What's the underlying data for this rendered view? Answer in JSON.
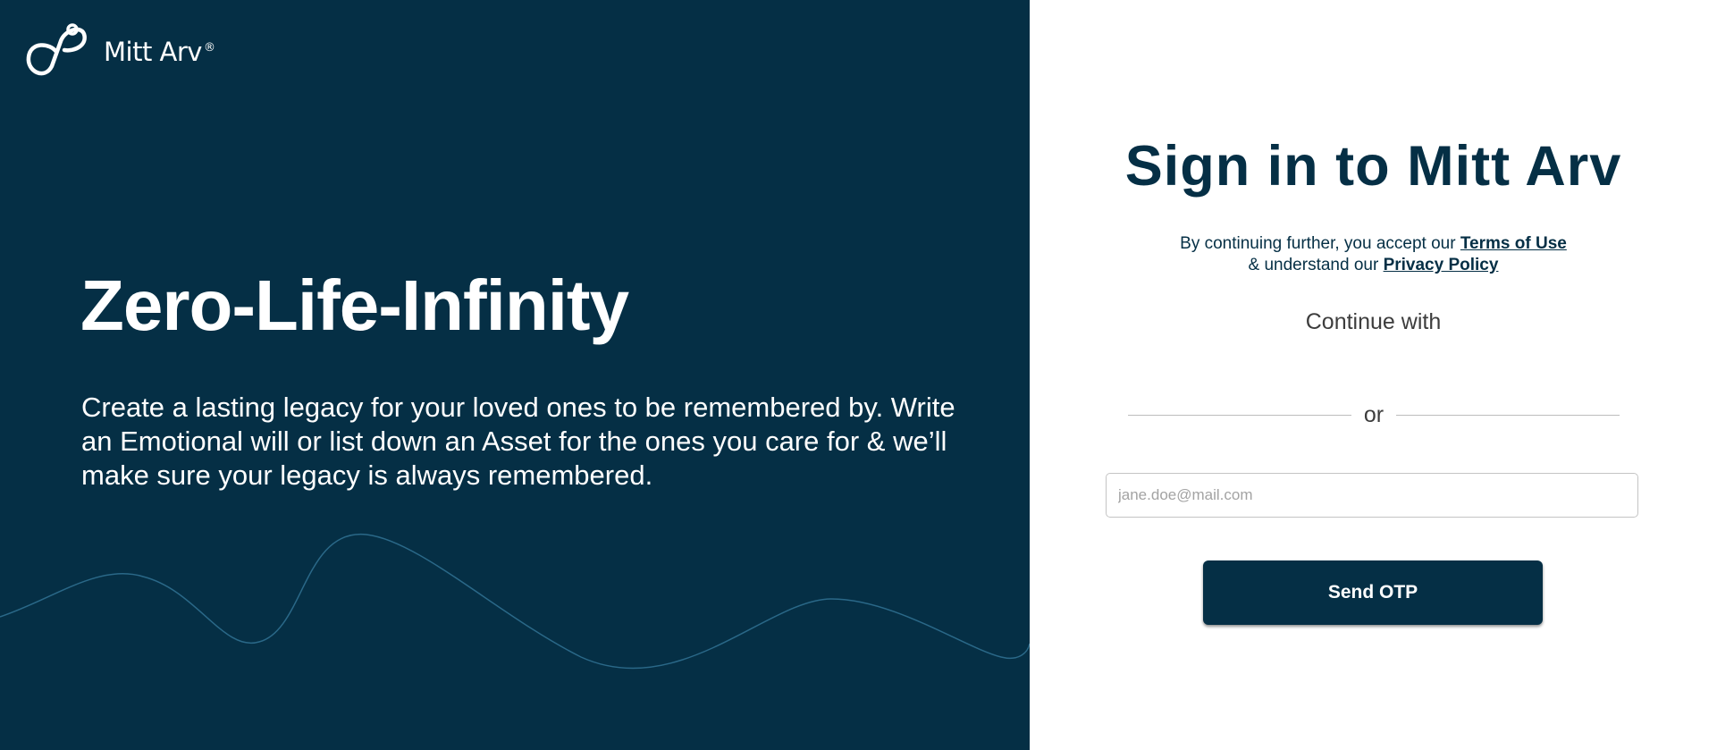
{
  "brand": {
    "logo_icon": "infinity-loop-icon",
    "name": "Mitt Arv",
    "registered_mark": "®"
  },
  "hero": {
    "title": "Zero-Life-Infinity",
    "description": "Create a lasting legacy for your loved ones to be remembered by. Write an Emotional will or list down an Asset for the ones you care for & we’ll make sure your legacy is always remembered."
  },
  "signin": {
    "title": "Sign in to Mitt Arv",
    "consent_prefix": "By continuing further, you accept our",
    "terms_label": "Terms of Use",
    "consent_middle": "& understand our",
    "privacy_label": "Privacy Policy",
    "continue_with": "Continue with",
    "divider_text": "or",
    "email_placeholder": "jane.doe@mail.com",
    "email_value": "",
    "send_button": "Send OTP"
  },
  "colors": {
    "brand_dark": "#052f45",
    "wave_stroke": "#2f6f8f",
    "background_right": "#ffffff"
  }
}
